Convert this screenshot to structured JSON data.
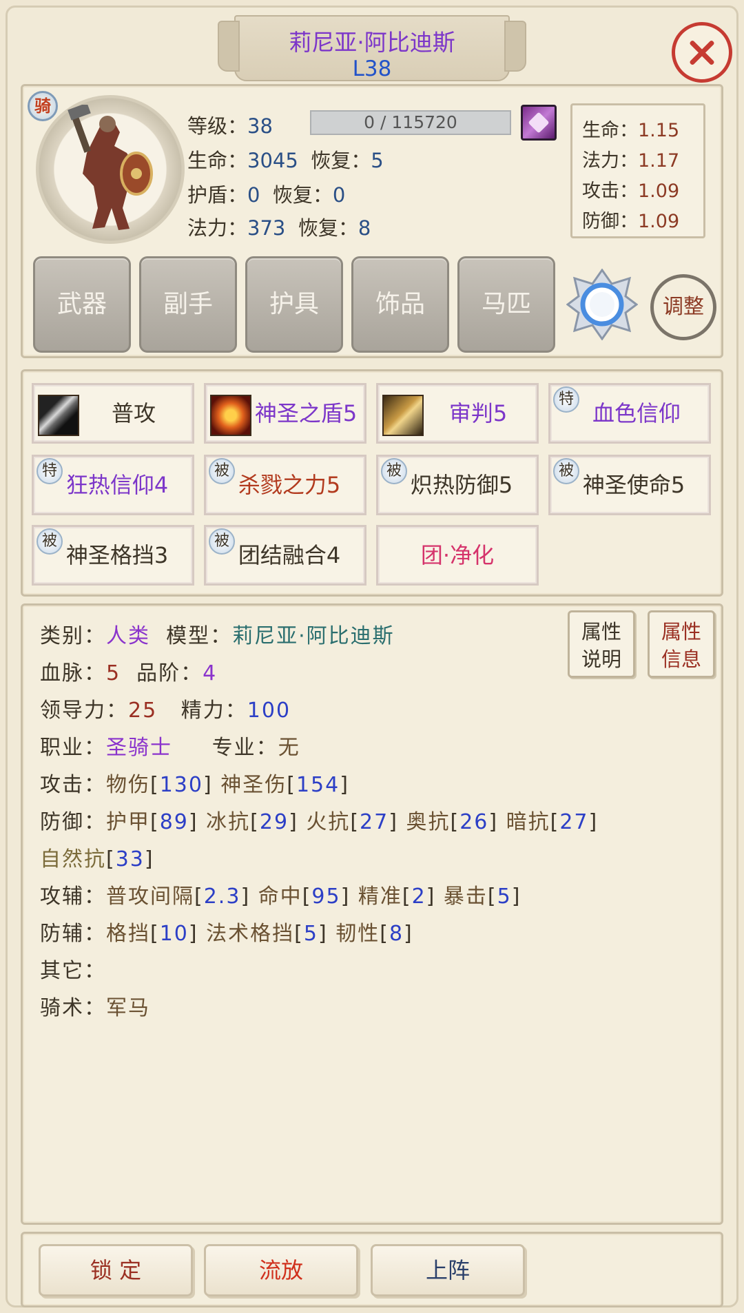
{
  "hero": {
    "name": "莉尼亚·阿比迪斯",
    "level_tag": "L38",
    "badge": "骑"
  },
  "stats": {
    "level_label": "等级：",
    "level_value": "38",
    "exp_text": "0 / 115720",
    "hp_label": "生命：",
    "hp_value": "3045",
    "hp_regen_label": "恢复：",
    "hp_regen_value": "5",
    "shield_label": "护盾：",
    "shield_value": "0",
    "shield_regen_label": "恢复：",
    "shield_regen_value": "0",
    "mana_label": "法力：",
    "mana_value": "373",
    "mana_regen_label": "恢复：",
    "mana_regen_value": "8"
  },
  "ratios": [
    {
      "label": "生命：",
      "value": "1.15"
    },
    {
      "label": "法力：",
      "value": "1.17"
    },
    {
      "label": "攻击：",
      "value": "1.09"
    },
    {
      "label": "防御：",
      "value": "1.09"
    }
  ],
  "slots": [
    "武器",
    "副手",
    "护具",
    "饰品",
    "马匹"
  ],
  "adjust_label": "调整",
  "skills": [
    {
      "name": "普攻",
      "tag": "",
      "icon": "sword-icon"
    },
    {
      "name": "神圣之盾5",
      "tag": "",
      "icon": "holy-shield-icon"
    },
    {
      "name": "审判5",
      "tag": "",
      "icon": "hammer-icon"
    },
    {
      "name": "血色信仰",
      "tag": "特",
      "icon": ""
    },
    {
      "name": "狂热信仰4",
      "tag": "特",
      "icon": ""
    },
    {
      "name": "杀戮之力5",
      "tag": "被",
      "icon": ""
    },
    {
      "name": "炽热防御5",
      "tag": "被",
      "icon": ""
    },
    {
      "name": "神圣使命5",
      "tag": "被",
      "icon": ""
    },
    {
      "name": "神圣格挡3",
      "tag": "被",
      "icon": ""
    },
    {
      "name": "团结融合4",
      "tag": "被",
      "icon": ""
    },
    {
      "name": "团·净化",
      "tag": "",
      "icon": ""
    }
  ],
  "info": {
    "type_label": "类别：",
    "type_value": "人类",
    "model_label": "模型：",
    "model_value": "莉尼亚·阿比迪斯",
    "blood_label": "血脉：",
    "blood_value": "5",
    "grade_label": "品阶：",
    "grade_value": "4",
    "lead_label": "领导力：",
    "lead_value": "25",
    "energy_label": "精力：",
    "energy_value": "100",
    "job_label": "职业：",
    "job_value": "圣骑士",
    "spec_label": "专业：",
    "spec_value": "无",
    "atk_label": "攻击：",
    "atk_items": [
      {
        "name": "物伤",
        "value": "130"
      },
      {
        "name": "神圣伤",
        "value": "154"
      }
    ],
    "def_label": "防御：",
    "def_items": [
      {
        "name": "护甲",
        "value": "89"
      },
      {
        "name": "冰抗",
        "value": "29"
      },
      {
        "name": "火抗",
        "value": "27"
      },
      {
        "name": "奥抗",
        "value": "26"
      },
      {
        "name": "暗抗",
        "value": "27"
      },
      {
        "name": "自然抗",
        "value": "33"
      }
    ],
    "atk_aux_label": "攻辅：",
    "atk_aux_items": [
      {
        "name": "普攻间隔",
        "value": "2.3"
      },
      {
        "name": "命中",
        "value": "95"
      },
      {
        "name": "精准",
        "value": "2"
      },
      {
        "name": "暴击",
        "value": "5"
      }
    ],
    "def_aux_label": "防辅：",
    "def_aux_items": [
      {
        "name": "格挡",
        "value": "10"
      },
      {
        "name": "法术格挡",
        "value": "5"
      },
      {
        "name": "韧性",
        "value": "8"
      }
    ],
    "other_label": "其它：",
    "ride_label": "骑术：",
    "ride_value": "军马"
  },
  "attr_buttons": [
    {
      "line1": "属性",
      "line2": "说明"
    },
    {
      "line1": "属性",
      "line2": "信息"
    }
  ],
  "bottom_buttons": {
    "lock": "锁 定",
    "exile": "流放",
    "deploy": "上阵"
  }
}
